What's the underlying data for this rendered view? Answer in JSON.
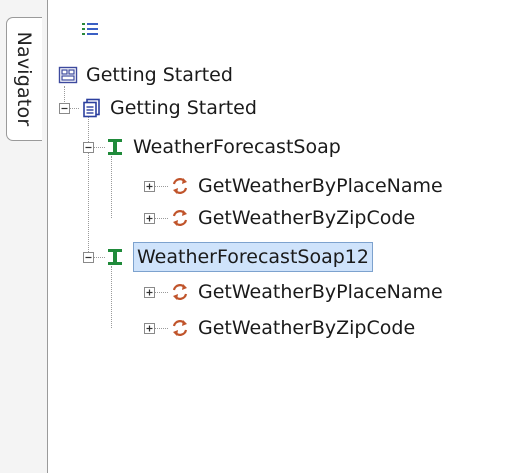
{
  "navigator_tab": {
    "label": "Navigator"
  },
  "toolbar": {
    "view_icon": "list-view-icon"
  },
  "tree": {
    "root": {
      "label": "Getting Started",
      "icon": "project-icon"
    },
    "project": {
      "label": "Getting Started",
      "icon": "document-icon"
    },
    "services": [
      {
        "label": "WeatherForecastSoap",
        "icon": "interface-icon",
        "operations": [
          {
            "label": "GetWeatherByPlaceName",
            "icon": "operation-icon"
          },
          {
            "label": "GetWeatherByZipCode",
            "icon": "operation-icon"
          }
        ]
      },
      {
        "label": "WeatherForecastSoap12",
        "icon": "interface-icon",
        "selected": true,
        "operations": [
          {
            "label": "GetWeatherByPlaceName",
            "icon": "operation-icon"
          },
          {
            "label": "GetWeatherByZipCode",
            "icon": "operation-icon"
          }
        ]
      }
    ]
  },
  "colors": {
    "selection_bg": "#cfe3fb",
    "selection_border": "#7da2ce",
    "interface_icon": "#1f8a3a",
    "operation_icon": "#c0542b",
    "document_icon": "#2b3f9e"
  }
}
